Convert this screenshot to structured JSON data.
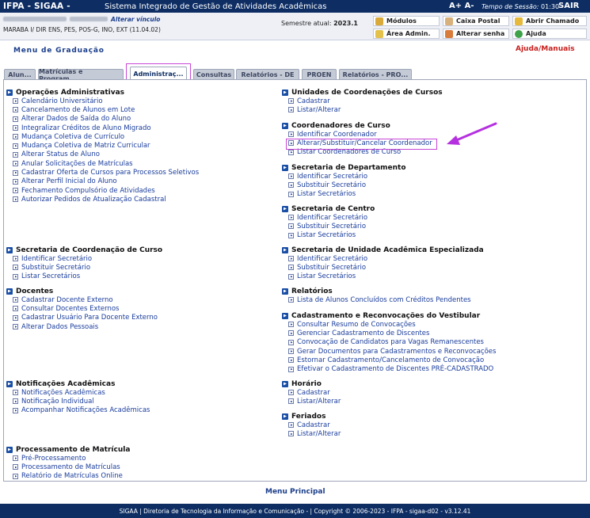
{
  "topbar": {
    "system": "IFPA - SIGAA -",
    "system_name": "Sistema Integrado de Gestão de Atividades Acadêmicas",
    "font_controls": "A+ A-",
    "session_label": "Tempo de Sessão:",
    "session_time": "01:30",
    "logout": "SAIR"
  },
  "user": {
    "vinculo_link": "Alterar vínculo",
    "unit": "MARABA I/ DIR ENS, PES, POS-G, INO, EXT (11.04.02)",
    "semester_label": "Semestre atual:",
    "semester_value": "2023.1"
  },
  "quick_links": {
    "modulos": "Módulos",
    "caixa_postal": "Caixa Postal",
    "abrir_chamado": "Abrir Chamado",
    "area_admin": "Área Admin.",
    "alterar_senha": "Alterar senha",
    "ajuda": "Ajuda"
  },
  "header": {
    "title": "Menu de Graduação",
    "help": "Ajuda/Manuais"
  },
  "tabs": [
    "Alun...",
    "Matrículas e Program...",
    "Administraç...",
    "Consultas",
    "Relatórios - DE",
    "PROEN",
    "Relatórios - PRO..."
  ],
  "left": [
    {
      "title": "Operações Administrativas",
      "items": [
        "Calendário Universitário",
        "Cancelamento de Alunos em Lote",
        "Alterar Dados de Saída do Aluno",
        "Integralizar Créditos de Aluno Migrado",
        "Mudança Coletiva de Currículo",
        "Mudança Coletiva de Matriz Curricular",
        "Alterar Status de Aluno",
        "Anular Solicitações de Matrículas",
        "Cadastrar Oferta de Cursos para Processos Seletivos",
        "Alterar Perfil Inicial do Aluno",
        "Fechamento Compulsório de Atividades",
        "Autorizar Pedidos de Atualização Cadastral"
      ]
    },
    {
      "title": "Secretaria de Coordenação de Curso",
      "items": [
        "Identificar Secretário",
        "Substituir Secretário",
        "Listar Secretários"
      ]
    },
    {
      "title": "Docentes",
      "items": [
        "Cadastrar Docente Externo",
        "Consultar Docentes Externos",
        "Cadastrar Usuário Para Docente Externo",
        "Alterar Dados Pessoais"
      ]
    },
    {
      "title": "Notificações Acadêmicas",
      "items": [
        "Notificações Acadêmicas",
        "Notificação Individual",
        "Acompanhar Notificações Acadêmicas"
      ]
    },
    {
      "title": "Processamento de Matrícula",
      "items": [
        "Pré-Processamento",
        "Processamento de Matrículas",
        "Relatório de Matrículas Online"
      ]
    }
  ],
  "right": [
    {
      "title": "Unidades de Coordenações de Cursos",
      "items": [
        "Cadastrar",
        "Listar/Alterar"
      ]
    },
    {
      "title": "Coordenadores de Curso",
      "items": [
        "Identificar Coordenador",
        "Alterar/Substituir/Cancelar Coordenador",
        "Listar Coordenadores de Curso"
      ]
    },
    {
      "title": "Secretaria de Departamento",
      "items": [
        "Identificar Secretário",
        "Substituir Secretário",
        "Listar Secretários"
      ]
    },
    {
      "title": "Secretaria de Centro",
      "items": [
        "Identificar Secretário",
        "Substituir Secretário",
        "Listar Secretários"
      ]
    },
    {
      "title": "Secretaria de Unidade Acadêmica Especializada",
      "items": [
        "Identificar Secretário",
        "Substituir Secretário",
        "Listar Secretários"
      ]
    },
    {
      "title": "Relatórios",
      "items": [
        "Lista de Alunos Concluídos com Créditos Pendentes"
      ]
    },
    {
      "title": "Cadastramento e Reconvocações do Vestibular",
      "items": [
        "Consultar Resumo de Convocações",
        "Gerenciar Cadastramento de Discentes",
        "Convocação de Candidatos para Vagas Remanescentes",
        "Gerar Documentos para Cadastramentos e Reconvocações",
        "Estornar Cadastramento/Cancelamento de Convocação",
        "Efetivar o Cadastramento de Discentes PRÉ-CADASTRADO"
      ]
    },
    {
      "title": "Horário",
      "items": [
        "Cadastrar",
        "Listar/Alterar"
      ]
    },
    {
      "title": "Feriados",
      "items": [
        "Cadastrar",
        "Listar/Alterar"
      ]
    }
  ],
  "menu_principal": "Menu Principal",
  "footer": "SIGAA | Diretoria de Tecnologia da Informação e Comunicação - | Copyright © 2006-2023 - IFPA - sigaa-d02 - v3.12.41",
  "colors": {
    "brand": "#0d2d63",
    "link": "#1a3d9c",
    "highlight": "#c946d8",
    "help": "#c8201e"
  }
}
